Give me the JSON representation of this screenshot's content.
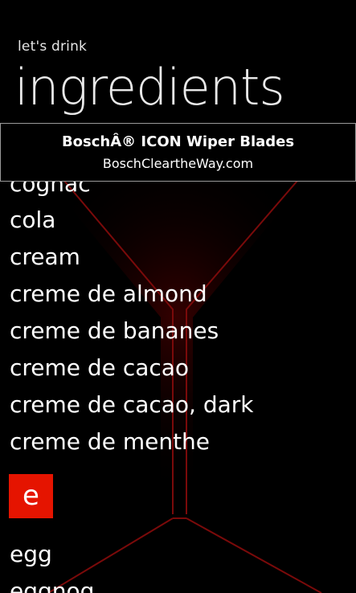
{
  "app": {
    "name": "let's drink"
  },
  "page": {
    "title": "ingredients"
  },
  "ad": {
    "title": "BoschÂ® ICON Wiper Blades",
    "url": "BoschCleartheWay.com"
  },
  "list": {
    "items": [
      "cognac",
      "cola",
      "cream",
      "creme de almond",
      "creme de bananes",
      "creme de cacao",
      "creme de cacao, dark",
      "creme de menthe"
    ],
    "group_letter": "e",
    "group_items": [
      "egg",
      "eggnog"
    ]
  },
  "colors": {
    "accent": "#e51400",
    "background": "#000000",
    "glass_line": "#7a0a0a"
  },
  "icons": {
    "background": "martini-glass-icon"
  }
}
